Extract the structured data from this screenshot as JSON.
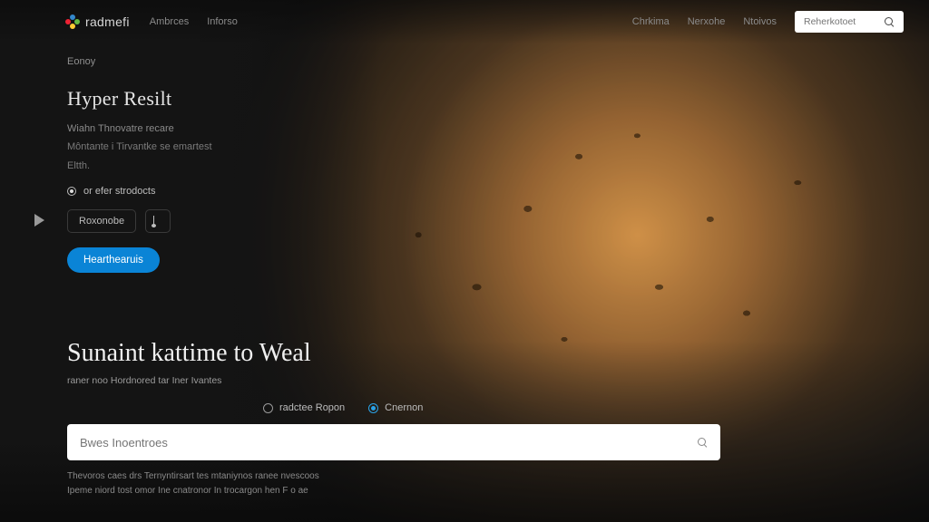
{
  "brand": {
    "name": "radmefi"
  },
  "nav": {
    "left": [
      "Ambrces",
      "Inforso"
    ],
    "right": [
      "Chrkima",
      "Nerxohe",
      "Ntoivos"
    ]
  },
  "header_search": {
    "placeholder": "Reherkotoet"
  },
  "panel": {
    "eyebrow": "Eonoy",
    "heading": "Hyper Resilt",
    "line1": "Wiahn Thnovatre recare",
    "line2": "Môntante i Tirvantke se emartest",
    "line3": "Eltth.",
    "radio_label": "or efer strodocts",
    "ghost_button": "Roxonobe",
    "primary_button": "Hearthearuis"
  },
  "lower": {
    "headline": "Sunaint kattime to Weal",
    "tagline": "raner noo Hordnored tar Iner Ivantes",
    "option_a": "radctee Ropon",
    "option_b": "Cnernon",
    "search_placeholder": "Bwes Inoentroes",
    "fineprint1": "Thevoros caes drs Ternyntirsart tes mtaniynos ranee nvescoos",
    "fineprint2": "Ipeme niord tost omor Ine cnatronor In trocargon hen F o ae"
  }
}
